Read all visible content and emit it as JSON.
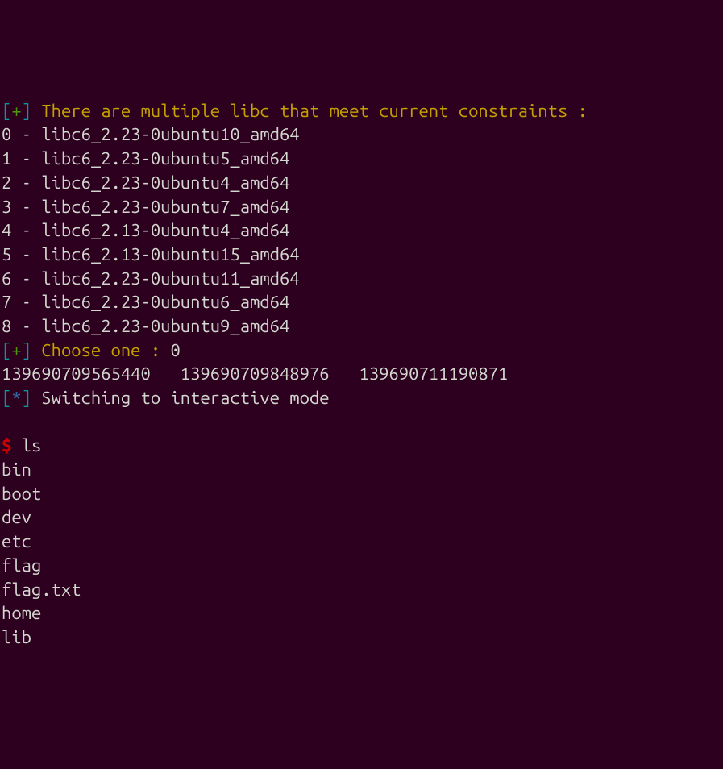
{
  "header": {
    "prefix_open": "[",
    "prefix_symbol": "+",
    "prefix_close": "]",
    "message": " There are multiple libc that meet current constraints :"
  },
  "libcs": [
    {
      "idx": "0",
      "name": "libc6_2.23-0ubuntu10_amd64"
    },
    {
      "idx": "1",
      "name": "libc6_2.23-0ubuntu5_amd64"
    },
    {
      "idx": "2",
      "name": "libc6_2.23-0ubuntu4_amd64"
    },
    {
      "idx": "3",
      "name": "libc6_2.23-0ubuntu7_amd64"
    },
    {
      "idx": "4",
      "name": "libc6_2.13-0ubuntu4_amd64"
    },
    {
      "idx": "5",
      "name": "libc6_2.13-0ubuntu15_amd64"
    },
    {
      "idx": "6",
      "name": "libc6_2.23-0ubuntu11_amd64"
    },
    {
      "idx": "7",
      "name": "libc6_2.23-0ubuntu6_amd64"
    },
    {
      "idx": "8",
      "name": "libc6_2.23-0ubuntu9_amd64"
    }
  ],
  "choose": {
    "prefix_open": "[",
    "prefix_symbol": "+",
    "prefix_close": "]",
    "label": " Choose one : ",
    "value": "0"
  },
  "numbers_line": "139690709565440   139690709848976   139690711190871",
  "switching": {
    "prefix_open": "[",
    "prefix_symbol": "*",
    "prefix_close": "]",
    "message": " Switching to interactive mode"
  },
  "shell": {
    "prompt": "$",
    "command": " ls"
  },
  "ls_output": [
    "bin",
    "boot",
    "dev",
    "etc",
    "flag",
    "flag.txt",
    "home",
    "lib"
  ]
}
